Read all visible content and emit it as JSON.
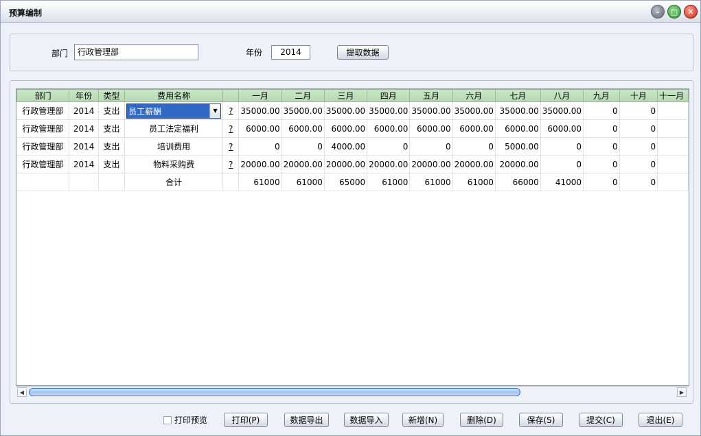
{
  "window": {
    "title": "预算编制",
    "controls": [
      "minimize-icon",
      "maximize-icon",
      "close-icon"
    ]
  },
  "filter": {
    "dept_label": "部门",
    "dept_value": "行政管理部",
    "year_label": "年份",
    "year_value": "2014",
    "fetch_button": "提取数据"
  },
  "table": {
    "headers": [
      "部门",
      "年份",
      "类型",
      "费用名称",
      "",
      "一月",
      "二月",
      "三月",
      "四月",
      "五月",
      "六月",
      "七月",
      "八月",
      "九月",
      "十月",
      "十一月"
    ],
    "rows": [
      {
        "dept": "行政管理部",
        "year": "2014",
        "type": "支出",
        "name": "员工薪酬",
        "help": "?",
        "values": [
          "35000.00",
          "35000.00",
          "35000.00",
          "35000.00",
          "35000.00",
          "35000.00",
          "35000.00",
          "35000.00",
          "0",
          "0",
          ""
        ]
      },
      {
        "dept": "行政管理部",
        "year": "2014",
        "type": "支出",
        "name": "员工法定福利",
        "help": "?",
        "values": [
          "6000.00",
          "6000.00",
          "6000.00",
          "6000.00",
          "6000.00",
          "6000.00",
          "6000.00",
          "6000.00",
          "0",
          "0",
          ""
        ]
      },
      {
        "dept": "行政管理部",
        "year": "2014",
        "type": "支出",
        "name": "培训费用",
        "help": "?",
        "values": [
          "0",
          "0",
          "4000.00",
          "0",
          "0",
          "0",
          "5000.00",
          "0",
          "0",
          "0",
          ""
        ]
      },
      {
        "dept": "行政管理部",
        "year": "2014",
        "type": "支出",
        "name": "物料采购费",
        "help": "?",
        "values": [
          "20000.00",
          "20000.00",
          "20000.00",
          "20000.00",
          "20000.00",
          "20000.00",
          "20000.00",
          "0",
          "0",
          "0",
          ""
        ]
      }
    ],
    "total": {
      "label": "合计",
      "values": [
        "61000",
        "61000",
        "65000",
        "61000",
        "61000",
        "61000",
        "66000",
        "41000",
        "0",
        "0",
        ""
      ]
    }
  },
  "footer": {
    "print_preview_label": "打印预览",
    "print_preview_checked": false,
    "buttons": {
      "print": "打印(P)",
      "export": "数据导出",
      "import": "数据导入",
      "add": "新增(N)",
      "delete": "删除(D)",
      "save": "保存(S)",
      "submit": "提交(C)",
      "exit": "退出(E)"
    }
  }
}
